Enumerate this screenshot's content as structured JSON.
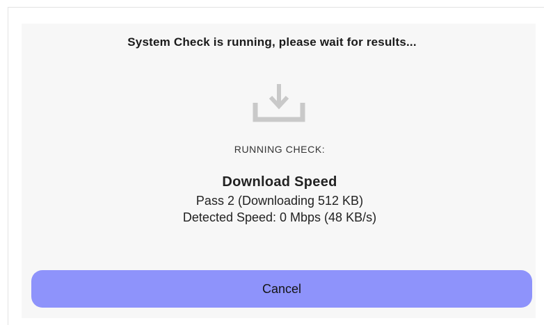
{
  "dialog": {
    "title": "System Check is running, please wait for results...",
    "icon": "download-icon",
    "status_label": "RUNNING CHECK:",
    "check_name": "Download Speed",
    "pass_info": "Pass 2 (Downloading 512 KB)",
    "detected_speed": "Detected Speed: 0 Mbps (48 KB/s)",
    "cancel_label": "Cancel"
  },
  "colors": {
    "button_bg": "#8e93fb",
    "icon": "#c9c9c9",
    "panel_bg": "#f7f7f7"
  }
}
